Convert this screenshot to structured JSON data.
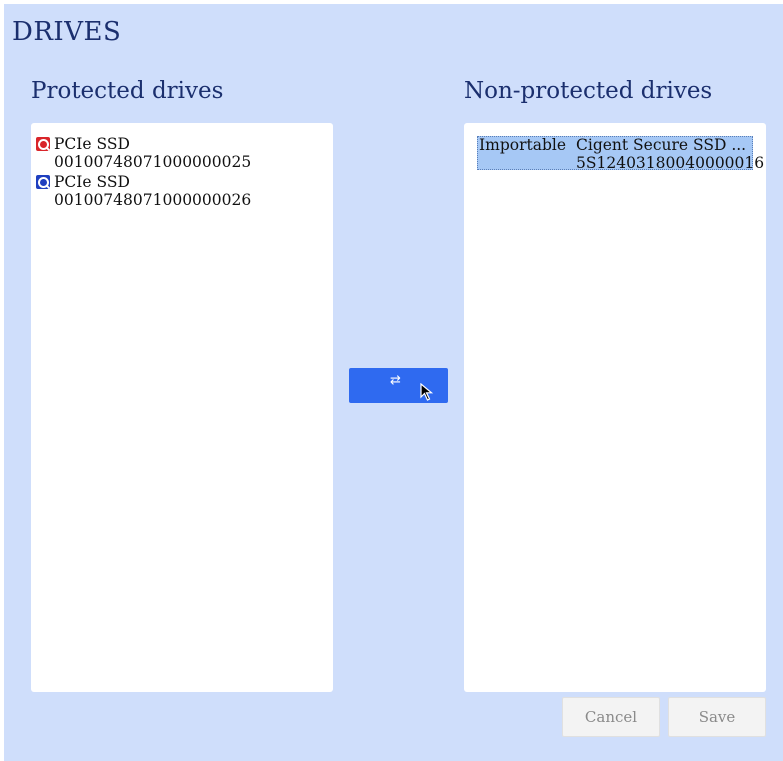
{
  "page": {
    "title": "DRIVES"
  },
  "protected": {
    "title": "Protected drives",
    "drives": [
      {
        "name": "PCIe SSD",
        "serial": "00100748071000000025",
        "icon": "drive-q-red-icon",
        "icon_color": "#d9252a"
      },
      {
        "name": "PCIe SSD",
        "serial": "00100748071000000026",
        "icon": "drive-q-blue-icon",
        "icon_color": "#1f3fbf"
      }
    ]
  },
  "nonprotected": {
    "title": "Non-protected drives",
    "drives": [
      {
        "status": "Importable",
        "name": "Cigent Secure SSD ...",
        "serial": "5S12403180040000016"
      }
    ]
  },
  "transfer_button": {
    "icon": "swap-arrows-icon",
    "cursor": "mouse-cursor-icon"
  },
  "footer": {
    "cancel_label": "Cancel",
    "save_label": "Save"
  },
  "colors": {
    "background": "#cfdefb",
    "accent": "#2f6af0",
    "heading": "#1b2f6e",
    "selection": "#a6c8f5"
  }
}
